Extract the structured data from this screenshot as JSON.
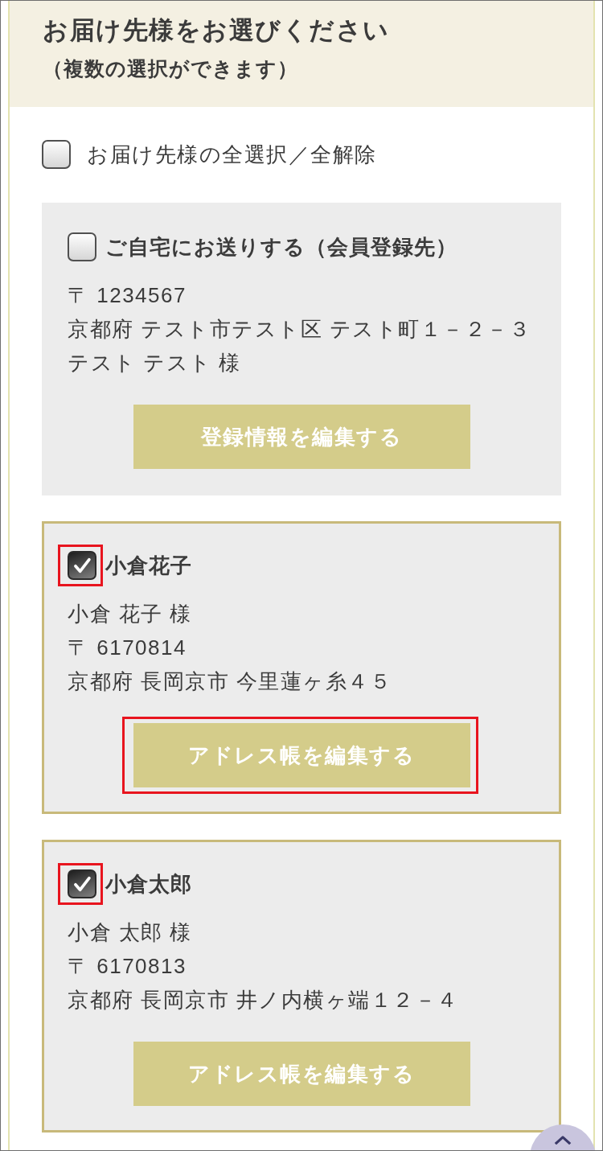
{
  "header": {
    "title": "お届け先様をお選びください",
    "subtitle": "（複数の選択ができます）"
  },
  "select_all": {
    "label": "お届け先様の全選択／全解除",
    "checked": false
  },
  "addresses": [
    {
      "title": "ご自宅にお送りする（会員登録先）",
      "checked": false,
      "checkbox_highlighted": false,
      "lines": [
        "〒 1234567",
        "京都府 テスト市テスト区 テスト町１－２－３",
        "テスト テスト 様"
      ],
      "button": "登録情報を編集する",
      "button_highlighted": false
    },
    {
      "title": "小倉花子",
      "checked": true,
      "checkbox_highlighted": true,
      "lines": [
        "小倉 花子 様",
        "〒 6170814",
        "京都府 長岡京市 今里蓮ヶ糸４５"
      ],
      "button": "アドレス帳を編集する",
      "button_highlighted": true
    },
    {
      "title": "小倉太郎",
      "checked": true,
      "checkbox_highlighted": true,
      "lines": [
        "小倉 太郎 様",
        "〒 6170813",
        "京都府 長岡京市 井ノ内横ヶ端１２－４"
      ],
      "button": "アドレス帳を編集する",
      "button_highlighted": false
    }
  ]
}
